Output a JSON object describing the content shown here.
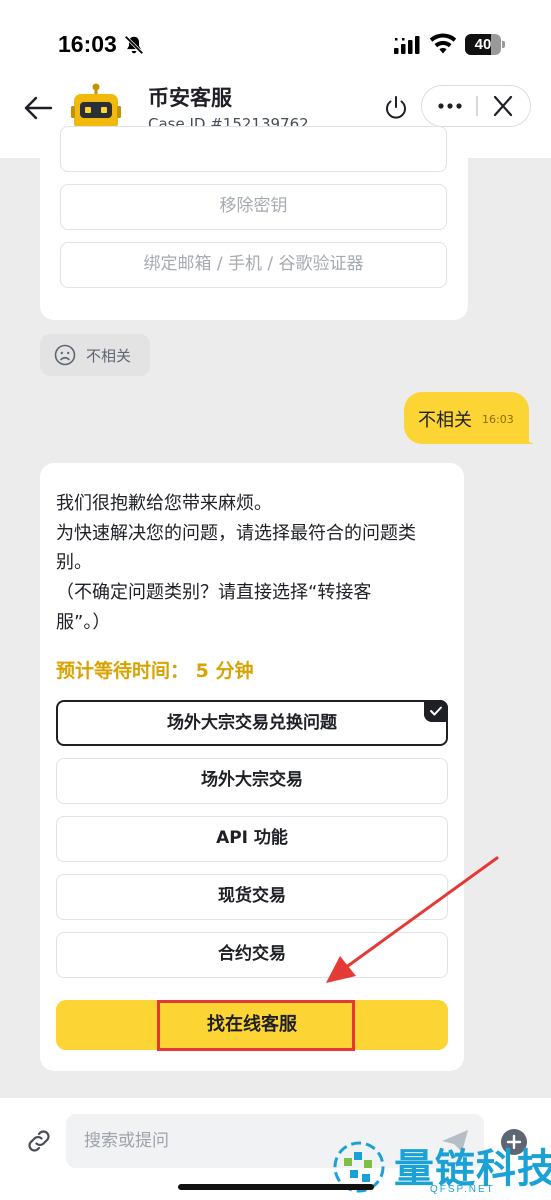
{
  "status_bar": {
    "time": "16:03",
    "battery": "40"
  },
  "header": {
    "title": "币安客服",
    "case_id": "Case ID #152139762"
  },
  "previous_options": [
    {
      "label": "移除密钥"
    },
    {
      "label": "绑定邮箱 / 手机 / 谷歌验证器"
    }
  ],
  "feedback_chip": {
    "label": "不相关",
    "icon": "sad-face-icon"
  },
  "user_message": {
    "text": "不相关",
    "time": "16:03"
  },
  "bot_message": {
    "lines": [
      "我们很抱歉给您带来麻烦。",
      "为快速解决您的问题，请选择最符合的问题类",
      "别。",
      "（不确定问题类别？请直接选择“转接客",
      "服”。）"
    ],
    "wait_time": "预计等待时间： 5 分钟"
  },
  "category_options": [
    {
      "label": "场外大宗交易兑换问题",
      "selected": true
    },
    {
      "label": "场外大宗交易",
      "selected": false
    },
    {
      "label": "API 功能",
      "selected": false
    },
    {
      "label": "现货交易",
      "selected": false
    },
    {
      "label": "合约交易",
      "selected": false
    }
  ],
  "cta": {
    "label": "找在线客服"
  },
  "composer": {
    "placeholder": "搜索或提问"
  },
  "watermark": {
    "text": "量链科技",
    "sub": "QFSP.NET"
  },
  "colors": {
    "brand_yellow": "#fcd535",
    "wait_time": "#d9a200",
    "annotation_red": "#e53935",
    "watermark_blue": "#1aa1d6"
  }
}
